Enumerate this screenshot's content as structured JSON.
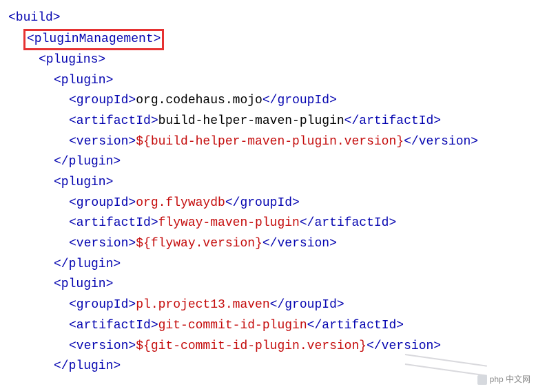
{
  "xml": {
    "build_open": "<build>",
    "pluginManagement_open": "<pluginManagement>",
    "plugins_open": "<plugins>",
    "plugin_open": "<plugin>",
    "plugin_close": "</plugin>",
    "groupId_open": "<groupId>",
    "groupId_close": "</groupId>",
    "artifactId_open": "<artifactId>",
    "artifactId_close": "</artifactId>",
    "version_open": "<version>",
    "version_close": "</version>"
  },
  "plugins": [
    {
      "groupId": "org.codehaus.mojo",
      "artifactId": "build-helper-maven-plugin",
      "version": "${build-helper-maven-plugin.version}"
    },
    {
      "groupId": "org.flywaydb",
      "artifactId": "flyway-maven-plugin",
      "version": "${flyway.version}"
    },
    {
      "groupId": "pl.project13.maven",
      "artifactId": "git-commit-id-plugin",
      "version": "${git-commit-id-plugin.version}"
    }
  ],
  "watermark": "php 中文网"
}
